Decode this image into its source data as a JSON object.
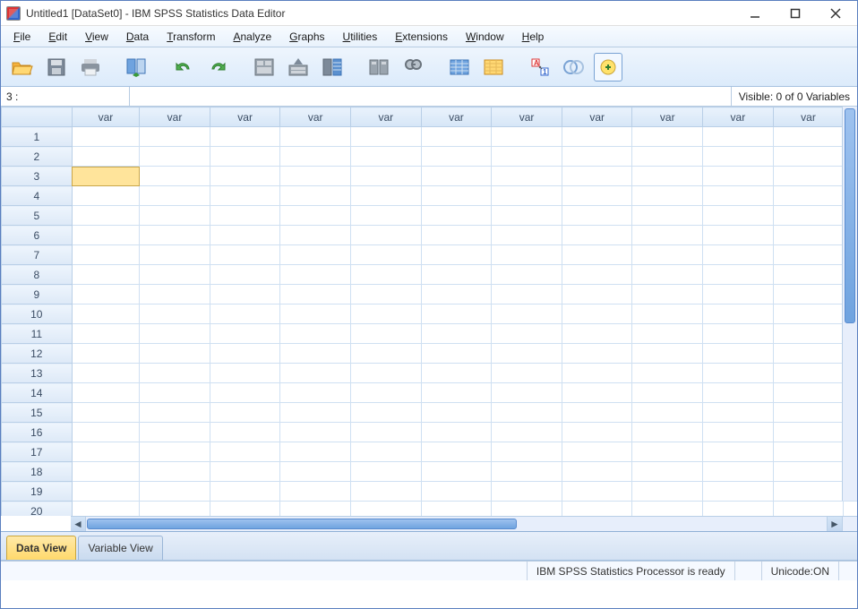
{
  "window": {
    "title": "Untitled1 [DataSet0] - IBM SPSS Statistics Data Editor"
  },
  "menu": {
    "items": [
      "File",
      "Edit",
      "View",
      "Data",
      "Transform",
      "Analyze",
      "Graphs",
      "Utilities",
      "Extensions",
      "Window",
      "Help"
    ]
  },
  "toolbar": {
    "icons": [
      "open-icon",
      "save-icon",
      "print-icon",
      "recall-dialog-icon",
      "undo-icon",
      "redo-icon",
      "goto-case-icon",
      "goto-variable-icon",
      "variables-icon",
      "run-descriptives-icon",
      "find-icon",
      "insert-cases-icon",
      "insert-variable-icon",
      "split-file-icon",
      "weight-cases-icon",
      "select-cases-icon",
      "value-labels-icon"
    ]
  },
  "indicator": {
    "cell_ref": "3 :",
    "visible_text": "Visible: 0 of 0 Variables"
  },
  "grid": {
    "col_header_label": "var",
    "num_cols": 12,
    "num_rows": 21,
    "selected": {
      "row": 3,
      "col": 1
    }
  },
  "tabs": {
    "data_view": "Data View",
    "variable_view": "Variable View",
    "active": "data_view"
  },
  "status": {
    "processor": "IBM SPSS Statistics Processor is ready",
    "unicode": "Unicode:ON"
  }
}
